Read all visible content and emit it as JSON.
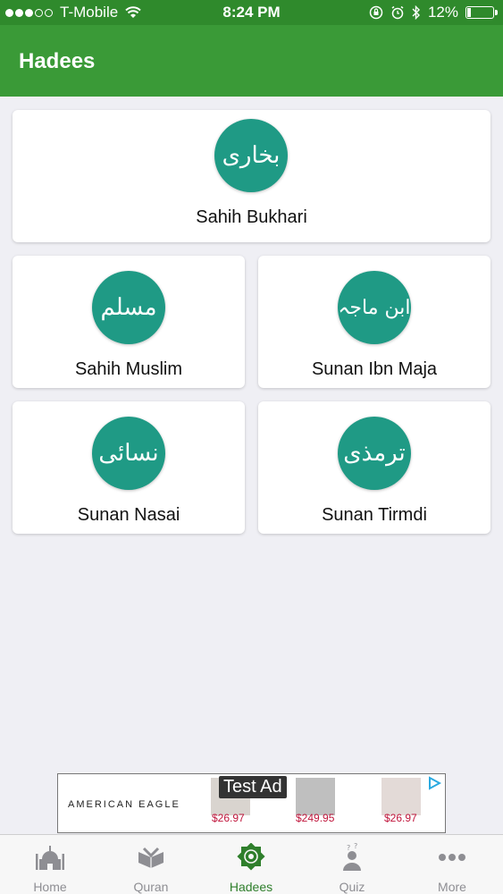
{
  "status_bar": {
    "carrier": "T-Mobile",
    "time": "8:24 PM",
    "battery": "12%",
    "battery_level": 0.12
  },
  "header": {
    "title": "Hadees"
  },
  "books": [
    {
      "name": "Sahih Bukhari",
      "arabic": "بخاری"
    },
    {
      "name": "Sahih Muslim",
      "arabic": "مسلم"
    },
    {
      "name": "Sunan Ibn Maja",
      "arabic": "ابن ماجہ"
    },
    {
      "name": "Sunan Nasai",
      "arabic": "نسائی"
    },
    {
      "name": "Sunan Tirmdi",
      "arabic": "ترمذی"
    }
  ],
  "ad": {
    "brand": "AMERICAN EAGLE",
    "label": "Test Ad",
    "prices": [
      "$26.97",
      "$249.95",
      "$26.97"
    ]
  },
  "tabs": [
    {
      "label": "Home",
      "icon": "mosque-icon"
    },
    {
      "label": "Quran",
      "icon": "quran-book-icon"
    },
    {
      "label": "Hadees",
      "icon": "star-emblem-icon"
    },
    {
      "label": "Quiz",
      "icon": "quiz-person-icon"
    },
    {
      "label": "More",
      "icon": "more-dots-icon"
    }
  ],
  "colors": {
    "app_bar": "#3a9a37",
    "badge": "#1f9a85",
    "active_tab": "#2f7f2c",
    "inactive_tab": "#8e8e93"
  }
}
